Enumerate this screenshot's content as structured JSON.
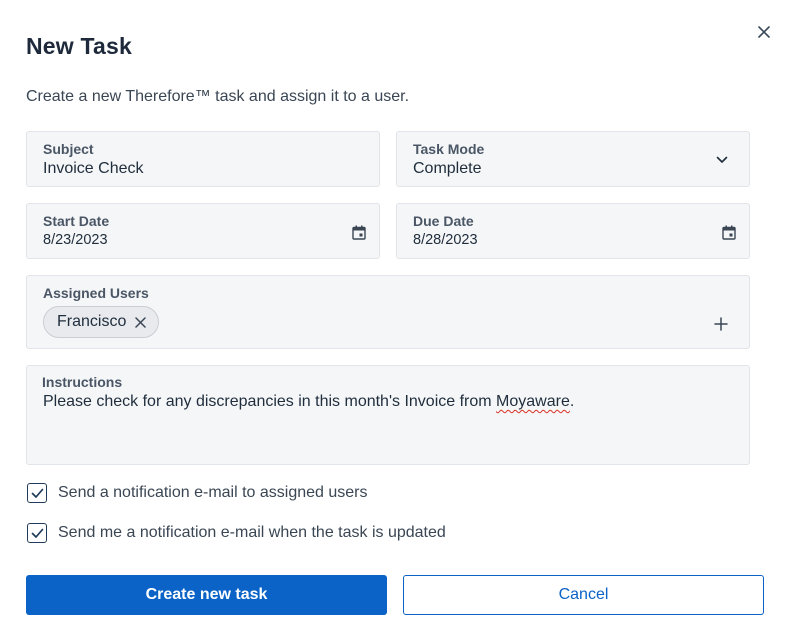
{
  "dialog": {
    "title": "New Task",
    "subtitle": "Create a new Therefore™ task and assign it to a user.",
    "close_icon": "close-icon"
  },
  "form": {
    "subject": {
      "label": "Subject",
      "value": "Invoice Check"
    },
    "task_mode": {
      "label": "Task Mode",
      "value": "Complete",
      "icon": "chevron-down-icon"
    },
    "start_date": {
      "label": "Start Date",
      "value": "8/23/2023",
      "icon": "calendar-icon"
    },
    "due_date": {
      "label": "Due Date",
      "value": "8/28/2023",
      "icon": "calendar-icon"
    },
    "assigned_users": {
      "label": "Assigned Users",
      "chips": [
        {
          "name": "Francisco"
        }
      ],
      "add_icon": "plus-icon"
    },
    "instructions": {
      "label": "Instructions",
      "text_before": "Please check for any discrepancies in this month's Invoice from ",
      "text_misspelled": "Moyaware",
      "text_after": "."
    }
  },
  "options": {
    "notify_assigned": {
      "label": "Send a notification e-mail to assigned users",
      "checked": true
    },
    "notify_me": {
      "label": "Send me a notification e-mail when the task is updated",
      "checked": true
    }
  },
  "actions": {
    "create_label": "Create new task",
    "cancel_label": "Cancel"
  },
  "colors": {
    "primary": "#0b63c7",
    "field_bg": "#f5f6f7",
    "text": "#1f2d3d"
  }
}
